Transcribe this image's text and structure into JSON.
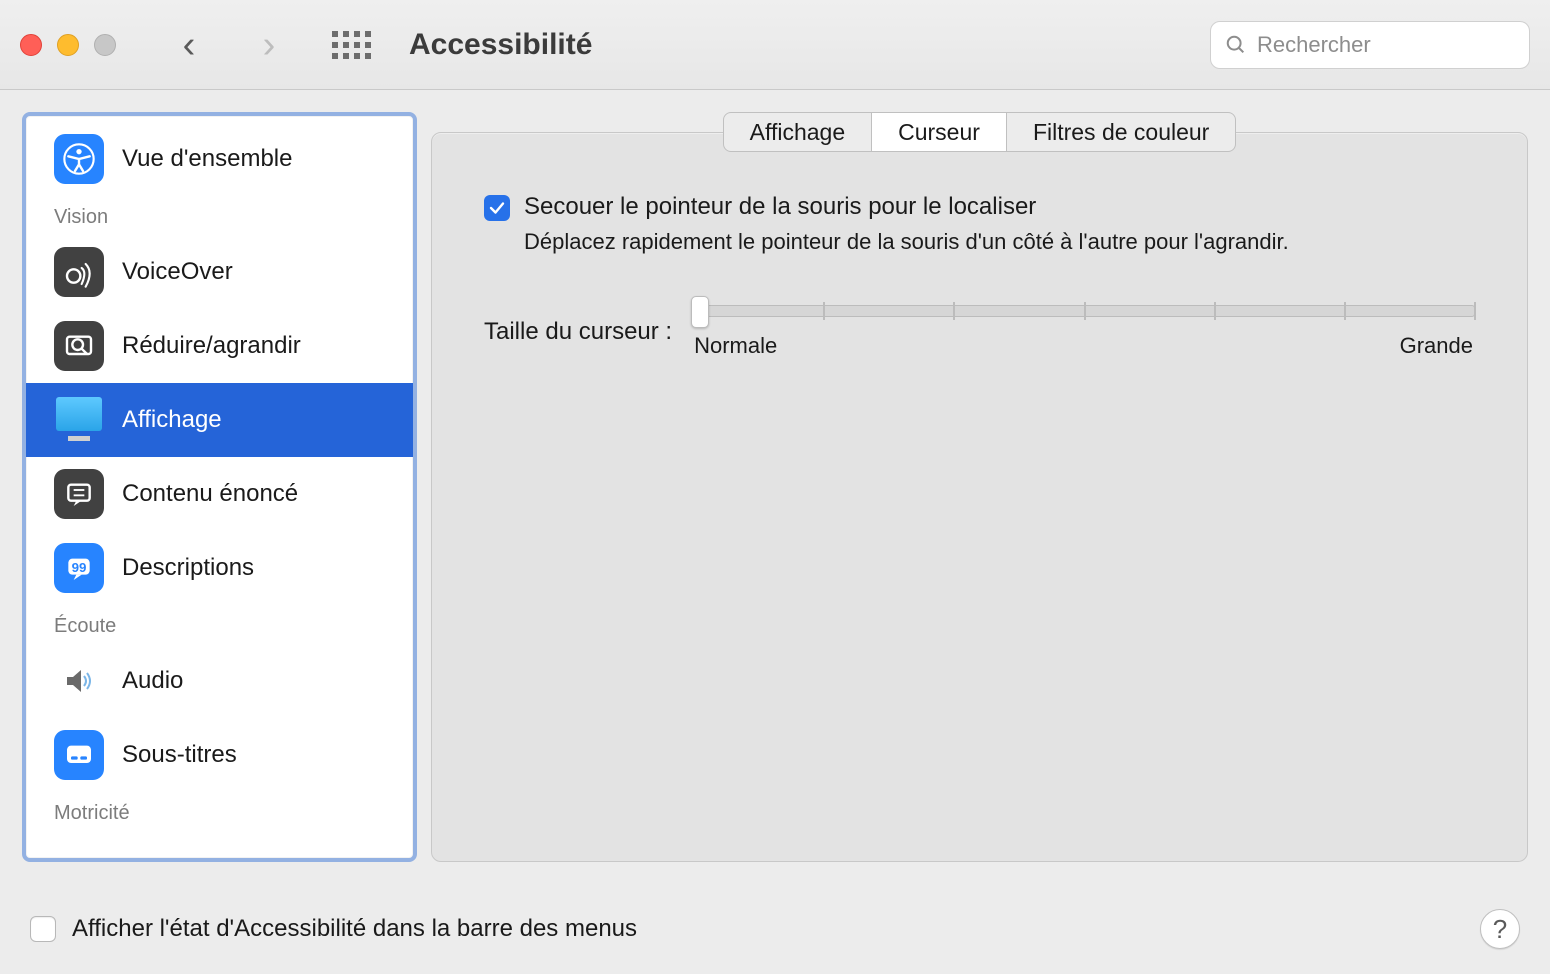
{
  "header": {
    "title": "Accessibilité",
    "search_placeholder": "Rechercher"
  },
  "sidebar": {
    "overview_label": "Vue d'ensemble",
    "sections": {
      "vision": {
        "label": "Vision"
      },
      "ecoute": {
        "label": "Écoute"
      },
      "motricite": {
        "label": "Motricité"
      }
    },
    "items": {
      "voiceover": "VoiceOver",
      "zoom": "Réduire/agrandir",
      "display": "Affichage",
      "spoken": "Contenu énoncé",
      "descriptions": "Descriptions",
      "audio": "Audio",
      "subtitles": "Sous-titres"
    }
  },
  "tabs": {
    "display": "Affichage",
    "cursor": "Curseur",
    "colorfilters": "Filtres de couleur"
  },
  "settings": {
    "shake_label": "Secouer le pointeur de la souris pour le localiser",
    "shake_desc": "Déplacez rapidement le pointeur de la souris d'un côté à l'autre pour l'agrandir.",
    "cursor_size_label": "Taille du curseur :",
    "cursor_size_min": "Normale",
    "cursor_size_max": "Grande",
    "cursor_size_value": 0,
    "cursor_size_ticks": 7
  },
  "footer": {
    "menubar_label": "Afficher l'état d'Accessibilité dans la barre des menus",
    "help": "?"
  }
}
